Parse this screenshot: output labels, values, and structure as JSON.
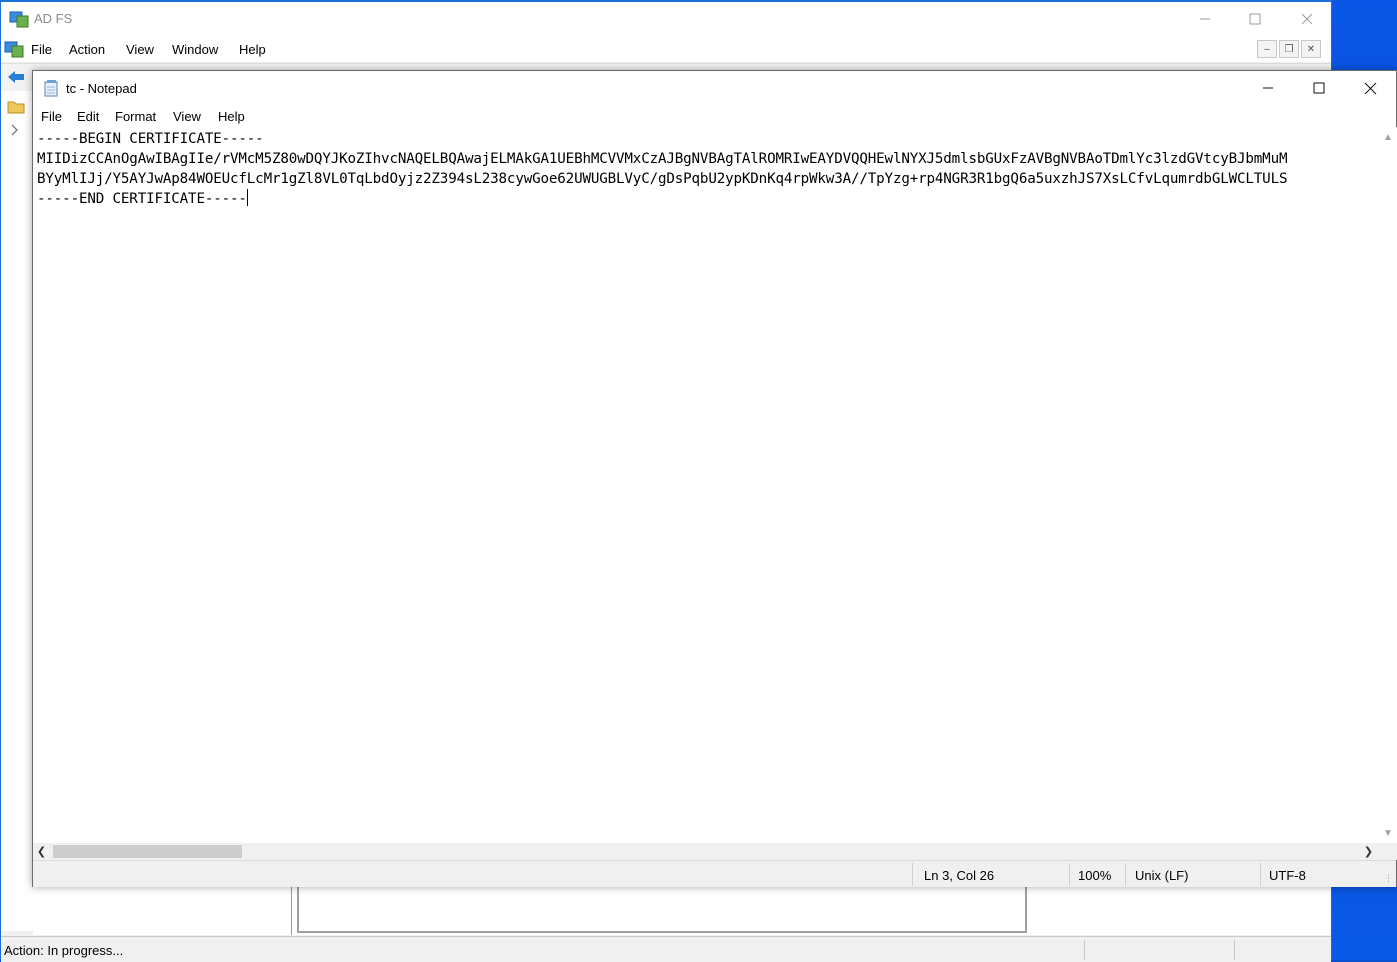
{
  "adfs": {
    "title": "AD FS",
    "menu": [
      "File",
      "Action",
      "View",
      "Window",
      "Help"
    ],
    "status": "Action:  In progress..."
  },
  "notepad": {
    "title": "tc - Notepad",
    "menu": [
      "File",
      "Edit",
      "Format",
      "View",
      "Help"
    ],
    "lines": [
      "-----BEGIN CERTIFICATE-----",
      "MIIDizCCAnOgAwIBAgIIe/rVMcM5Z80wDQYJKoZIhvcNAQELBQAwajELMAkGA1UEBhMCVVMxCzAJBgNVBAgTAlROMRIwEAYDVQQHEwlNYXJ5dmlsbGUxFzAVBgNVBAoTDmlYc3lzdGVtcyBJbmMuM",
      "BYyMlIJj/Y5AYJwAp84WOEUcfLcMr1gZl8VL0TqLbdOyjz2Z394sL238cywGoe62UWUGBLVyC/gDsPqbU2ypKDnKq4rpWkw3A//TpYzg+rp4NGR3R1bgQ6a5uxzhJS7XsLCfvLqumrdbGLWCLTULS",
      "-----END CERTIFICATE-----"
    ],
    "status": {
      "position": "Ln 3, Col 26",
      "zoom": "100%",
      "line_ending": "Unix (LF)",
      "encoding": "UTF-8"
    }
  },
  "icons": {
    "minimize": "minimize-icon",
    "maximize": "maximize-icon",
    "close": "close-icon",
    "back": "back-arrow-icon",
    "folder": "folder-icon"
  }
}
